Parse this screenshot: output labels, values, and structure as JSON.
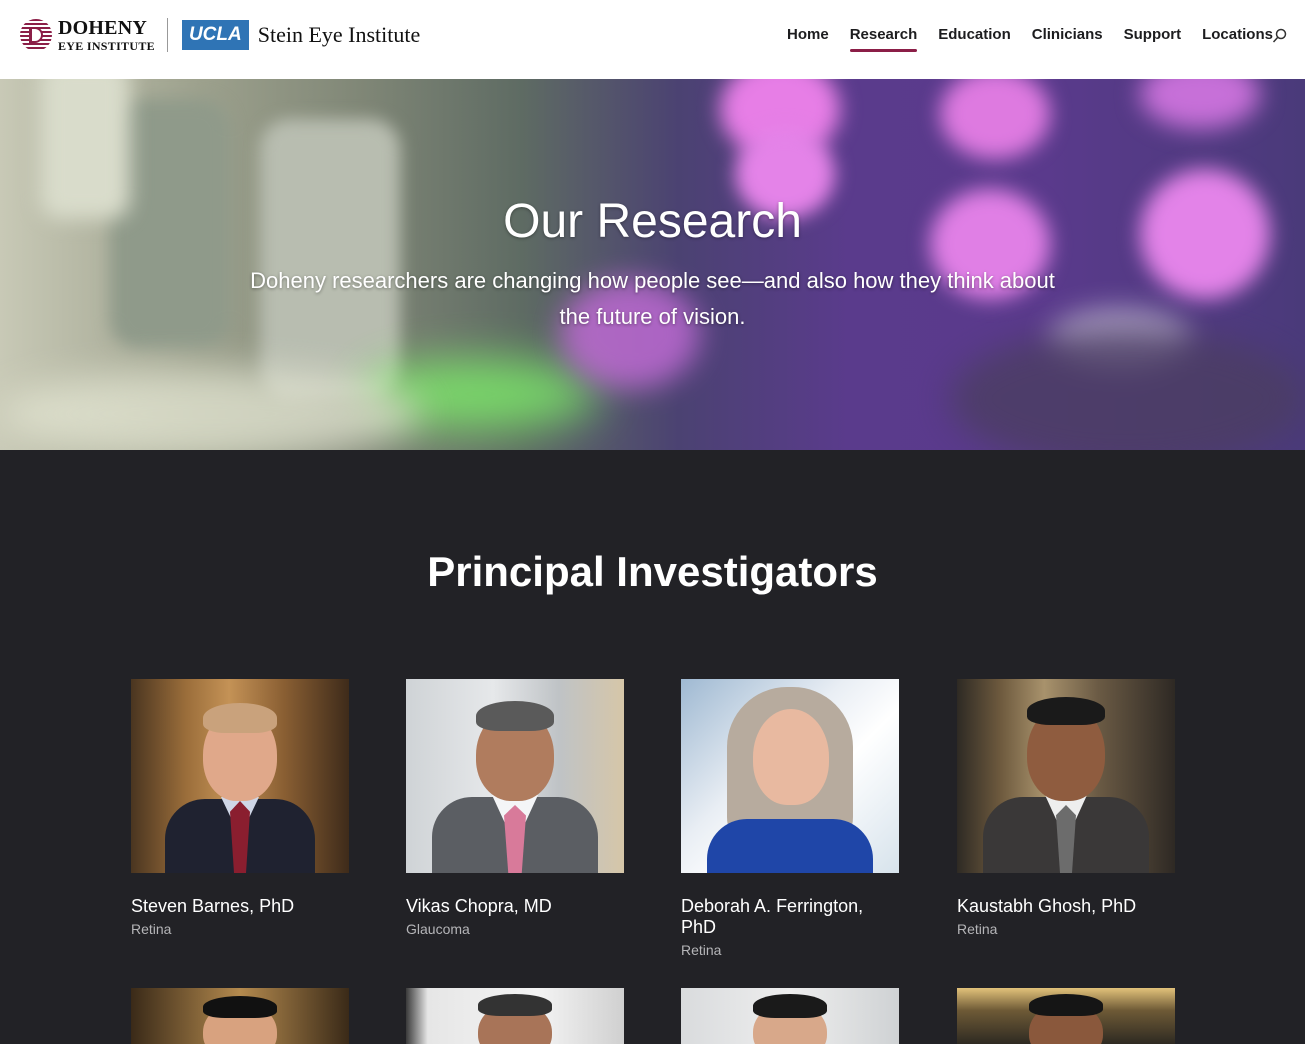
{
  "header": {
    "logo_doheny_line1": "DOHENY",
    "logo_doheny_line2": "EYE INSTITUTE",
    "logo_ucla": "UCLA",
    "logo_stein": "Stein Eye Institute",
    "nav": [
      "Home",
      "Research",
      "Education",
      "Clinicians",
      "Support",
      "Locations"
    ],
    "active_nav": "Research",
    "accent_color": "#8b1e47"
  },
  "hero": {
    "title": "Our Research",
    "subtitle": "Doheny researchers are changing how people see—and also how they think about the future of vision."
  },
  "investigators": {
    "title": "Principal Investigators",
    "people": [
      {
        "name": "Steven Barnes, PhD",
        "specialty": "Retina"
      },
      {
        "name": "Vikas Chopra, MD",
        "specialty": "Glaucoma"
      },
      {
        "name": "Deborah A. Ferrington, PhD",
        "specialty": "Retina"
      },
      {
        "name": "Kaustabh Ghosh, PhD",
        "specialty": "Retina"
      }
    ]
  },
  "colors": {
    "page_background": "#222226",
    "header_background": "#ffffff",
    "ucla_blue": "#2f74b5"
  }
}
